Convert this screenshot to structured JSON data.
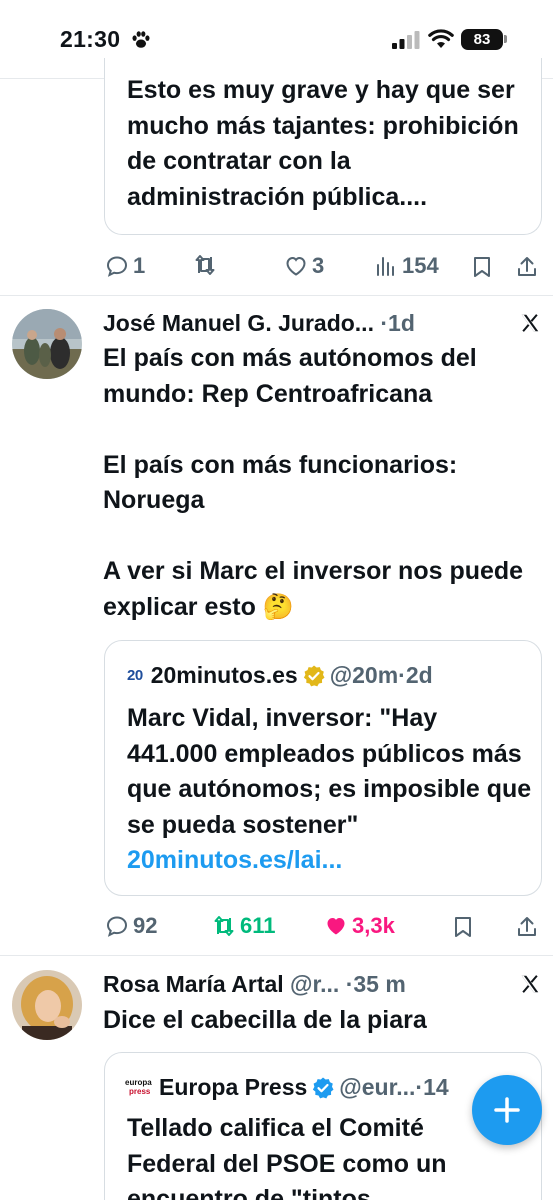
{
  "status_bar": {
    "time": "21:30",
    "battery": "83",
    "icons": [
      "paw-icon",
      "signal-icon",
      "wifi-icon",
      "battery-icon"
    ]
  },
  "quote_top": {
    "text": "Esto es muy grave y hay que ser mucho más tajantes: prohibición de contratar con la administración pública...."
  },
  "actions_top": {
    "replies": "1",
    "retweets": "",
    "likes": "3",
    "views": "154"
  },
  "tweet1": {
    "author": "José Manuel G. Jurado...",
    "time": "1d",
    "body": "El país con más autónomos del mundo: Rep Centroafricana\n\nEl país con más funcionarios: Noruega\n\nA ver si Marc el inversor nos puede explicar esto 🤔",
    "quote": {
      "logo": "20",
      "name": "20minutos.es",
      "handle": "@20m",
      "time": "2d",
      "text": "Marc Vidal, inversor: \"Hay 441.000 empleados públicos más que autónomos; es imposible que se pueda sostener\"",
      "link": "20minutos.es/lai..."
    },
    "actions": {
      "replies": "92",
      "retweets": "611",
      "likes": "3,3k"
    }
  },
  "tweet2": {
    "author": "Rosa María Artal",
    "handle": "@r...",
    "time": "35 m",
    "body": "Dice el cabecilla de la piara",
    "quote": {
      "logo_text_1": "europa",
      "logo_text_2": "press",
      "name": "Europa Press",
      "handle": "@eur...",
      "time": "14",
      "text_line1": "Tellado califica el Comité",
      "text_line2": "Federal del PSOE como un",
      "text_line3": "encuentro de \"tintos"
    }
  },
  "colors": {
    "accent": "#1d9bf0",
    "like": "#f91880",
    "retweet": "#00ba7c",
    "muted": "#536471"
  }
}
